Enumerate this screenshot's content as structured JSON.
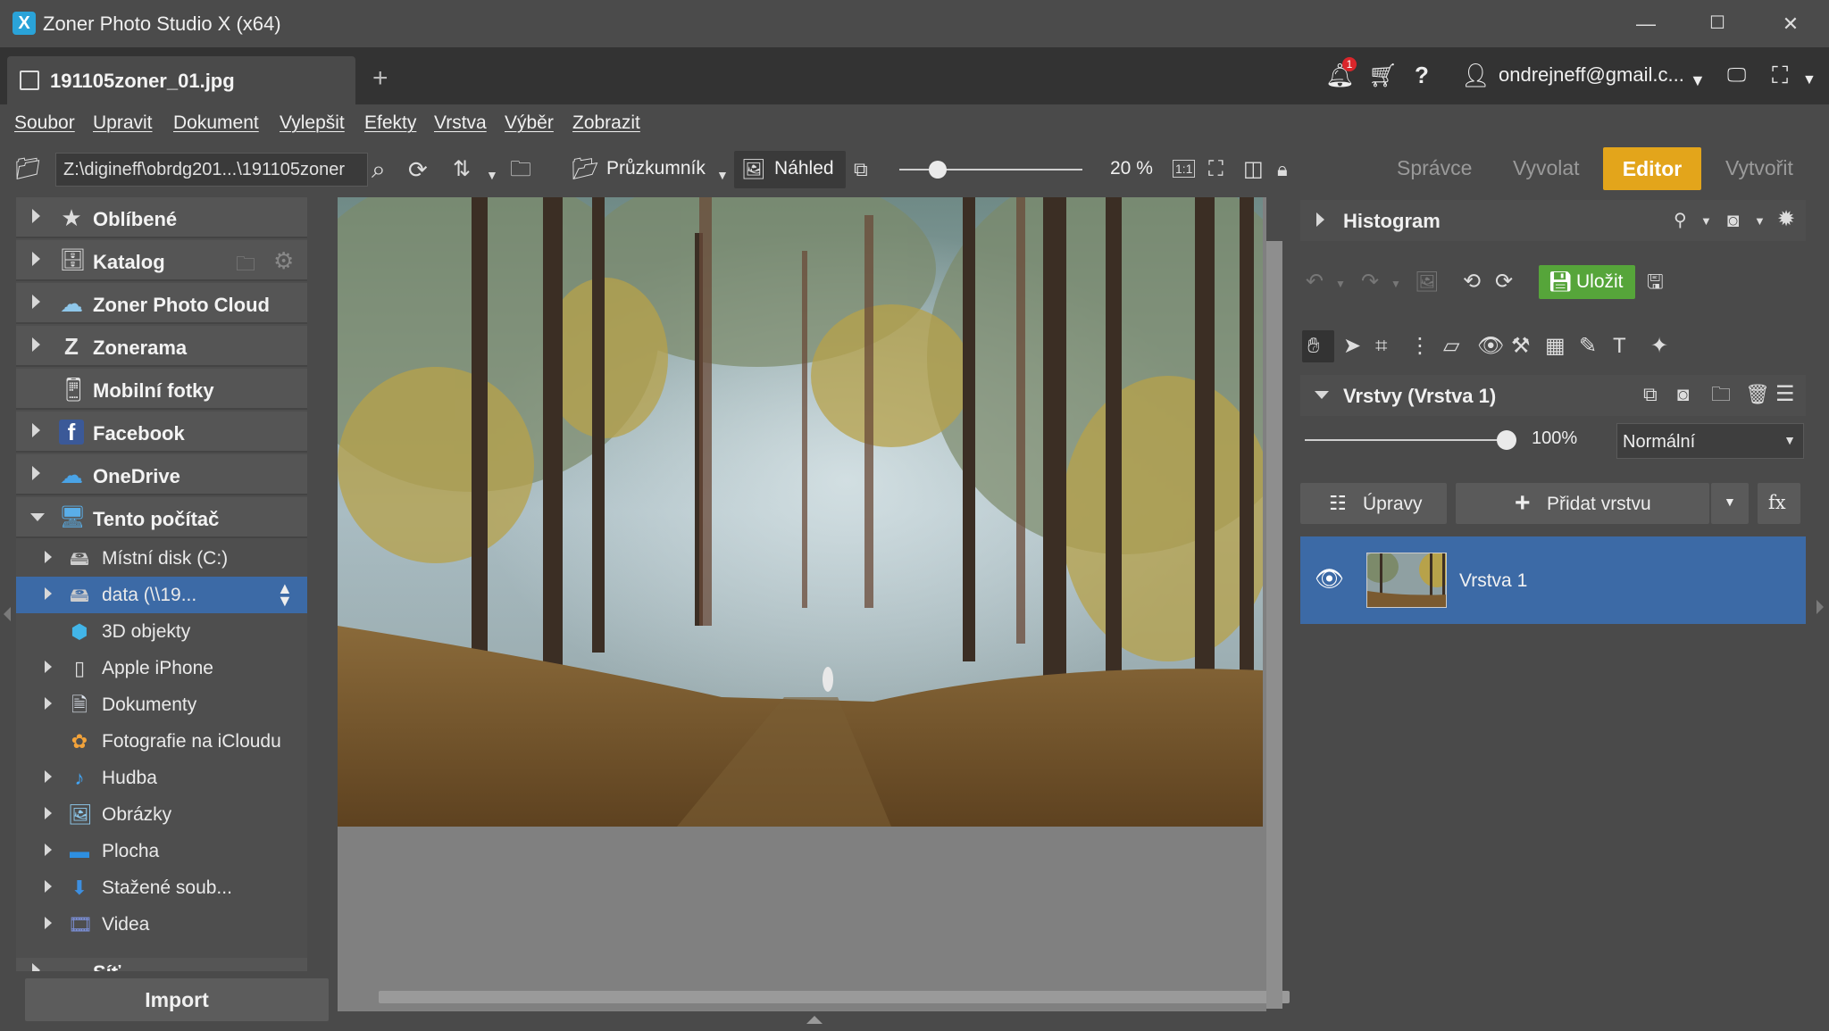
{
  "window": {
    "title": "Zoner Photo Studio X (x64)",
    "logo": "X",
    "minimize": "—",
    "maximize": "☐",
    "close": "✕"
  },
  "tabs": {
    "active_title": "191105zoner_01.jpg",
    "new_tab": "+"
  },
  "topbar": {
    "notification_count": "1",
    "user_email": "ondrejneff@gmail.c..."
  },
  "menu": [
    "Soubor",
    "Upravit",
    "Dokument",
    "Vylepšit",
    "Efekty",
    "Vrstva",
    "Výběr",
    "Zobrazit"
  ],
  "toolbar": {
    "path": "Z:\\digineff\\obrdg201...\\191105zoner",
    "explorer_label": "Průzkumník",
    "preview_label": "Náhled",
    "zoom_label": "20 %",
    "zoom_level": 0.15
  },
  "modes": {
    "manager": "Správce",
    "develop": "Vyvolat",
    "editor": "Editor",
    "create": "Vytvořit",
    "accent_color": "#e3a51b"
  },
  "navigator": {
    "items": [
      {
        "label": "Oblíbené",
        "icon": "star-icon"
      },
      {
        "label": "Katalog",
        "icon": "catalog-icon"
      },
      {
        "label": "Zoner Photo Cloud",
        "icon": "cloud-icon"
      },
      {
        "label": "Zonerama",
        "icon": "zonerama-icon"
      },
      {
        "label": "Mobilní fotky",
        "icon": "phone-icon"
      },
      {
        "label": "Facebook",
        "icon": "facebook-icon"
      },
      {
        "label": "OneDrive",
        "icon": "onedrive-icon"
      },
      {
        "label": "Tento počítač",
        "icon": "computer-icon"
      }
    ],
    "computer_children": [
      {
        "label": "Místní disk (C:)"
      },
      {
        "label": "data (\\\\19..."
      },
      {
        "label": "3D objekty"
      },
      {
        "label": "Apple iPhone"
      },
      {
        "label": "Dokumenty"
      },
      {
        "label": "Fotografie na iCloudu"
      },
      {
        "label": "Hudba"
      },
      {
        "label": "Obrázky"
      },
      {
        "label": "Plocha"
      },
      {
        "label": "Stažené soub..."
      },
      {
        "label": "Videa"
      }
    ],
    "cut_off_item": "Síť",
    "import_label": "Import"
  },
  "right_panel": {
    "histogram_label": "Histogram",
    "save_label": "Uložit",
    "layers_header": "Vrstvy (Vrstva 1)",
    "opacity": "100%",
    "blend_mode": "Normální",
    "adjustments_label": "Úpravy",
    "add_layer_label": "Přidat vrstvu",
    "fx_label": "fx",
    "layer_name": "Vrstva 1",
    "save_color": "#56a53a",
    "selected_layer_color": "#3c6aa6"
  }
}
